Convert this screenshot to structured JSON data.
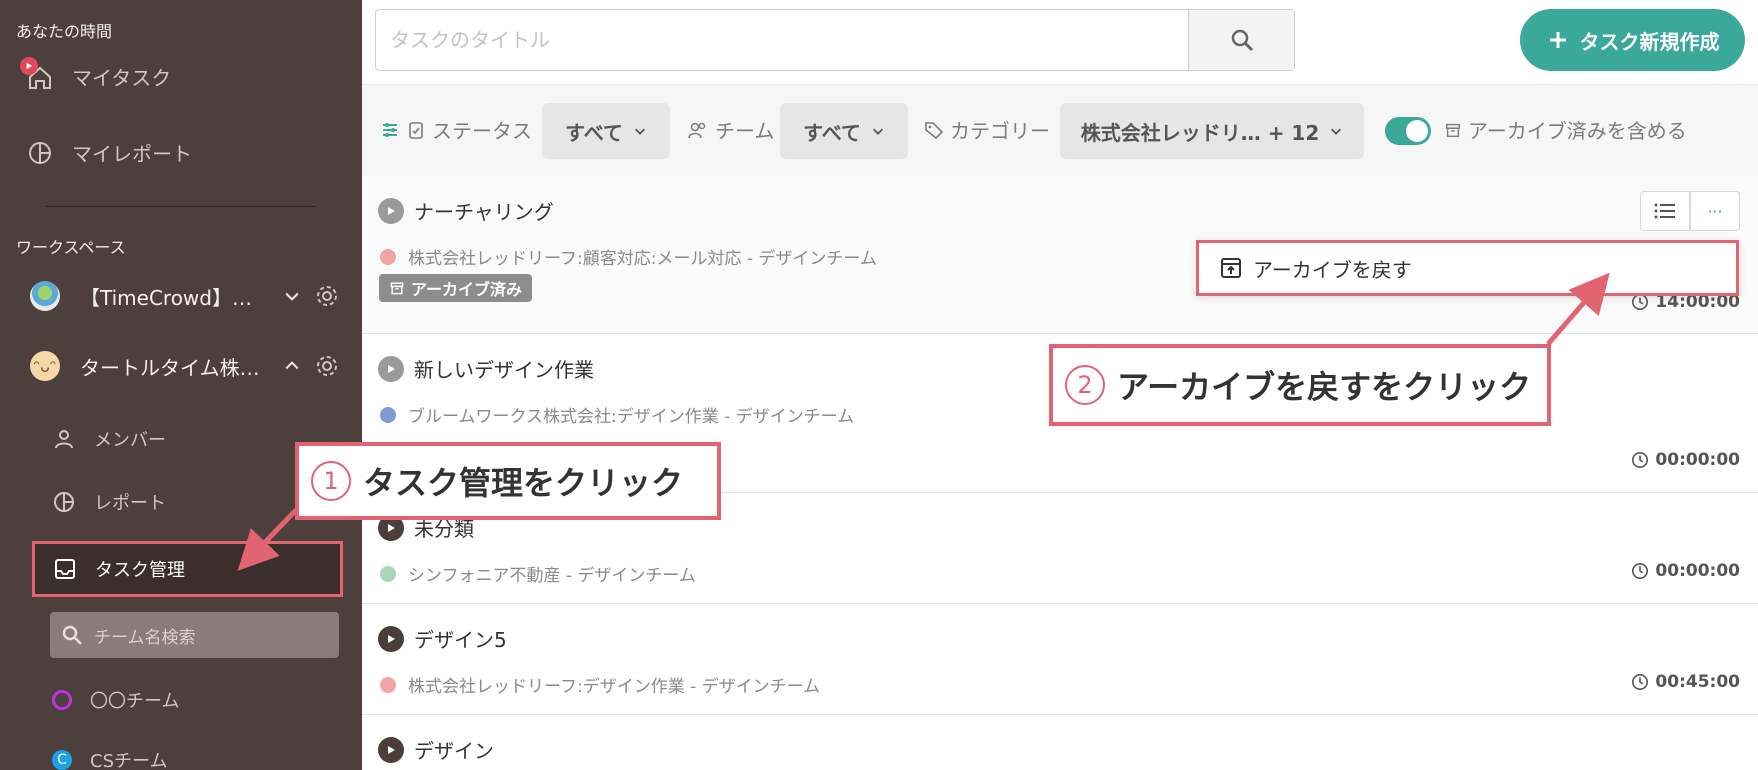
{
  "sidebar": {
    "your_time_heading": "あなたの時間",
    "my_tasks": "マイタスク",
    "my_report": "マイレポート",
    "workspace_heading": "ワークスペース",
    "workspaces": [
      {
        "name": "【TimeCrowd】…",
        "expanded": false
      },
      {
        "name": "タートルタイム株…",
        "expanded": true
      }
    ],
    "members": "メンバー",
    "reports": "レポート",
    "task_management": "タスク管理",
    "team_search_placeholder": "チーム名検索",
    "teams": [
      {
        "name": "〇〇チーム",
        "color": "#c032e0"
      },
      {
        "name": "CSチーム",
        "color": "#1aa3e8"
      }
    ]
  },
  "search": {
    "placeholder": "タスクのタイトル"
  },
  "new_task_label": "タスク新規作成",
  "filters": {
    "status_label": "ステータス",
    "status_value": "すべて",
    "team_label": "チーム",
    "team_value": "すべて",
    "category_label": "カテゴリー",
    "category_value": "株式会社レッドリ… + 12",
    "include_archived_label": "アーカイブ済みを含める",
    "include_archived": true
  },
  "tasks": [
    {
      "title": "ナーチャリング",
      "sub": "株式会社レッドリーフ:顧客対応:メール対応 - デザインチーム",
      "dot": "#f0a5a5",
      "archived_badge": "アーカイブ済み",
      "time": "14:00:00"
    },
    {
      "title": "新しいデザイン作業",
      "sub": "ブルームワークス株式会社:デザイン作業 - デザインチーム",
      "dot": "#7f9ad6",
      "time": "00:00:00"
    },
    {
      "title": "未分類",
      "sub": "シンフォニア不動産 - デザインチーム",
      "dot": "#a8d8b9",
      "time": "00:00:00"
    },
    {
      "title": "デザイン5",
      "sub": "株式会社レッドリーフ:デザイン作業 - デザインチーム",
      "dot": "#f0a5a5",
      "time": "00:45:00"
    },
    {
      "title": "デザイン"
    }
  ],
  "menu": {
    "unarchive": "アーカイブを戻す",
    "more": "···"
  },
  "callouts": {
    "step1_num": "1",
    "step1_text": "タスク管理をクリック",
    "step2_num": "2",
    "step2_text": "アーカイブを戻すをクリック"
  },
  "colors": {
    "accent": "#3aa99a",
    "annotation": "#e26472",
    "sidebar": "#4d3f3b"
  }
}
